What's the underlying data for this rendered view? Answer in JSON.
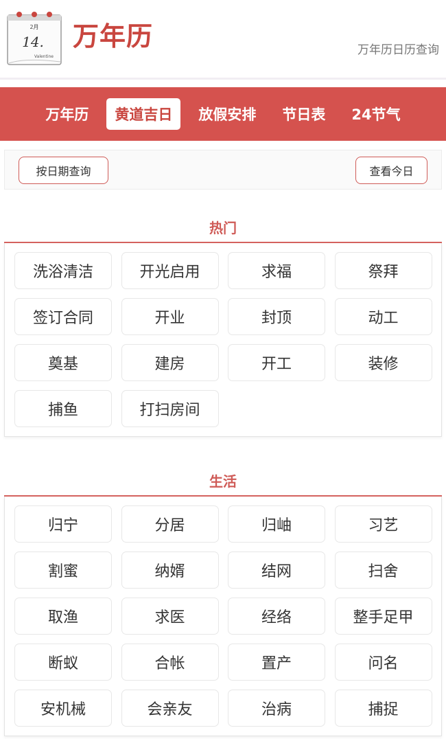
{
  "header": {
    "title": "万年历",
    "subtitle": "万年历日历查询",
    "logo": {
      "icon": "calendar-page-icon",
      "month": "2月",
      "day": "14.",
      "caption": "Valentine"
    }
  },
  "nav": {
    "items": [
      {
        "label": "万年历",
        "active": false
      },
      {
        "label": "黄道吉日",
        "active": true
      },
      {
        "label": "放假安排",
        "active": false
      },
      {
        "label": "节日表",
        "active": false
      },
      {
        "label": "24节气",
        "active": false
      }
    ]
  },
  "toolbar": {
    "query_by_date": "按日期查询",
    "view_today": "查看今日"
  },
  "sections": [
    {
      "title": "热门",
      "tags": [
        "洗浴清洁",
        "开光启用",
        "求福",
        "祭拜",
        "签订合同",
        "开业",
        "封顶",
        "动工",
        "奠基",
        "建房",
        "开工",
        "装修",
        "捕鱼",
        "打扫房间"
      ]
    },
    {
      "title": "生活",
      "tags": [
        "归宁",
        "分居",
        "归岫",
        "习艺",
        "割蜜",
        "纳婿",
        "结网",
        "扫舍",
        "取渔",
        "求医",
        "经络",
        "整手足甲",
        "断蚁",
        "合帐",
        "置产",
        "问名",
        "安机械",
        "会亲友",
        "治病",
        "捕捉"
      ]
    }
  ],
  "colors": {
    "accent": "#d5524e",
    "accent_text": "#c9463f"
  }
}
